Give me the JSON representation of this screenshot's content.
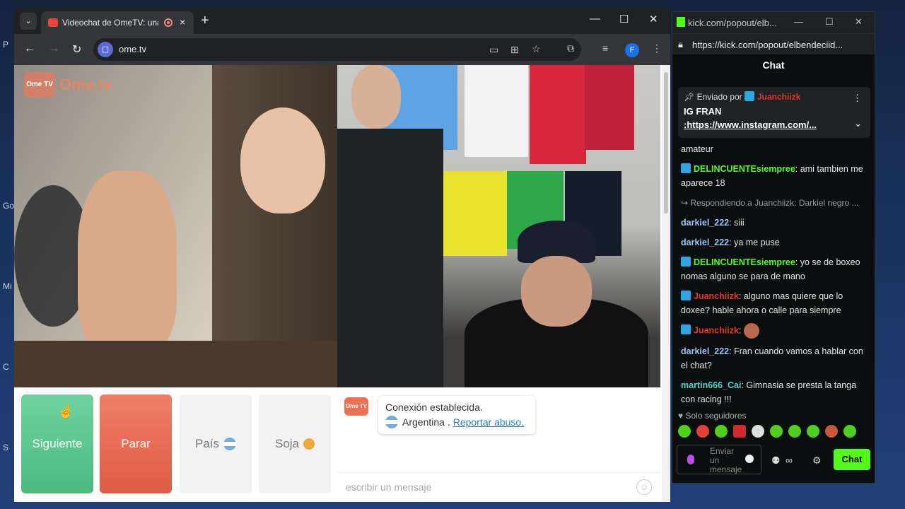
{
  "desktop": {
    "labels": [
      "P",
      "Go",
      "Mi",
      "C",
      "S"
    ]
  },
  "browser": {
    "tab_title": "Videochat de OmeTV: una a",
    "tab_close": "×",
    "new_tab": "+",
    "url": "ome.tv",
    "profile_initial": "F",
    "win_min": "—",
    "win_max": "☐",
    "win_close": "✕"
  },
  "ome": {
    "logo_box": "Ome TV",
    "logo_text": "Ome.tv",
    "buttons": {
      "next": "Siguiente",
      "stop": "Parar",
      "country": "País",
      "gender": "Soja"
    },
    "system": {
      "icon_label": "Ome TV",
      "connected": "Conexión establecida.",
      "country": "Argentina .",
      "report": "Reportar abuso."
    },
    "message_placeholder": "escribir un mensaje"
  },
  "kick": {
    "window_title": "kick.com/popout/elb...",
    "url": "https://kick.com/popout/elbendeciid...",
    "chat_heading": "Chat",
    "pinned": {
      "sent_by_label": "Enviado por",
      "sender": "Juanchiizk",
      "title": "IG FRAN",
      "link": ":https://www.instagram.com/..."
    },
    "messages": [
      {
        "user": "",
        "text": "amateur",
        "color": "plain"
      },
      {
        "user": "DELINCUENTEsiempree",
        "text": "ami tambien me aparece 18",
        "color": "green"
      },
      {
        "reply": "Respondiendo a Juanchiizk: Darkiel negro ..."
      },
      {
        "user": "darkiel_222",
        "text": "siii",
        "color": "blue"
      },
      {
        "user": "darkiel_222",
        "text": "ya me puse",
        "color": "blue"
      },
      {
        "user": "DELINCUENTEsiempree",
        "text": "yo se de boxeo nomas alguno se para de mano",
        "color": "green"
      },
      {
        "user": "Juanchiizk",
        "text": "alguno mas quiere que lo doxee? hable ahora o calle para siempre",
        "color": "red"
      },
      {
        "user": "Juanchiizk",
        "text": "",
        "color": "red"
      },
      {
        "user": "darkiel_222",
        "text": "Fran cuando vamos a hablar con el chat?",
        "color": "blue"
      },
      {
        "user": "martin666_Cai",
        "text": "Gimnasia se presta la tanga con racing !!!",
        "color": "teal"
      }
    ],
    "followers_only": "Solo seguidores",
    "compose_placeholder": "Enviar un mensaje",
    "chat_button": "Chat"
  }
}
